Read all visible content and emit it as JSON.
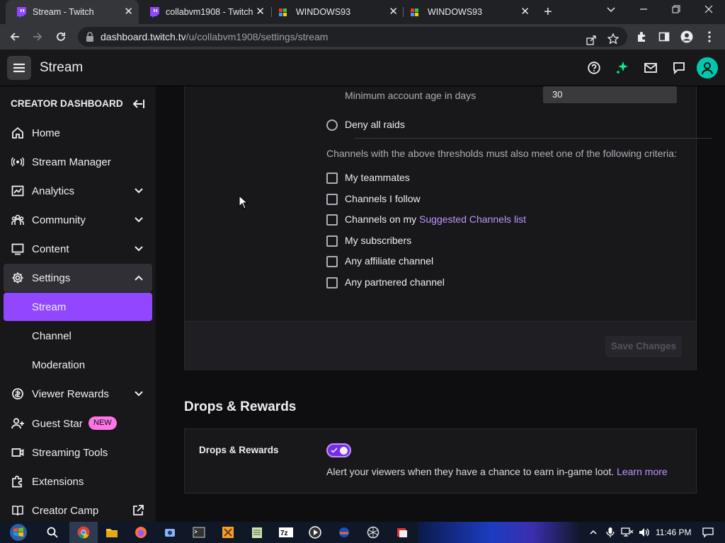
{
  "browser": {
    "tabs": [
      {
        "title": "Stream - Twitch",
        "active": true
      },
      {
        "title": "collabvm1908 - Twitch",
        "active": false
      },
      {
        "title": "WINDOWS93",
        "active": false
      },
      {
        "title": "WINDOWS93",
        "active": false
      }
    ],
    "url_host": "dashboard.twitch.tv",
    "url_path": "/u/collabvm1908/settings/stream"
  },
  "topnav": {
    "title": "Stream"
  },
  "sidebar": {
    "header": "CREATOR DASHBOARD",
    "items": [
      {
        "label": "Home",
        "icon": "home-icon"
      },
      {
        "label": "Stream Manager",
        "icon": "broadcast-icon"
      },
      {
        "label": "Analytics",
        "icon": "analytics-icon"
      },
      {
        "label": "Community",
        "icon": "community-icon"
      },
      {
        "label": "Content",
        "icon": "content-icon"
      },
      {
        "label": "Settings",
        "icon": "gear-icon"
      },
      {
        "label": "Stream"
      },
      {
        "label": "Channel"
      },
      {
        "label": "Moderation"
      },
      {
        "label": "Viewer Rewards",
        "icon": "rewards-icon"
      },
      {
        "label": "Guest Star",
        "icon": "add-person-icon",
        "badge": "NEW"
      },
      {
        "label": "Streaming Tools",
        "icon": "camera-icon"
      },
      {
        "label": "Extensions",
        "icon": "puzzle-icon"
      },
      {
        "label": "Creator Camp",
        "icon": "book-icon"
      }
    ]
  },
  "raids": {
    "min_age_label": "Minimum account age in days",
    "min_age_value": "30",
    "deny_all_label": "Deny all raids",
    "criteria_text": "Channels with the above thresholds must also meet one of the following criteria:",
    "criteria": [
      {
        "label": "My teammates"
      },
      {
        "label": "Channels I follow"
      },
      {
        "label_prefix": "Channels on my ",
        "link": "Suggested Channels list"
      },
      {
        "label": "My subscribers"
      },
      {
        "label": "Any affiliate channel"
      },
      {
        "label": "Any partnered channel"
      }
    ],
    "save_label": "Save Changes"
  },
  "drops": {
    "section_title": "Drops & Rewards",
    "label": "Drops & Rewards",
    "toggle_on": true,
    "description": "Alert your viewers when they have a chance to earn in-game loot.",
    "learn_more": "Learn more"
  },
  "taskbar": {
    "time": "11:46 PM"
  },
  "colors": {
    "accent": "#9147ff",
    "link": "#bf94ff",
    "badge": "#ff75e6"
  }
}
